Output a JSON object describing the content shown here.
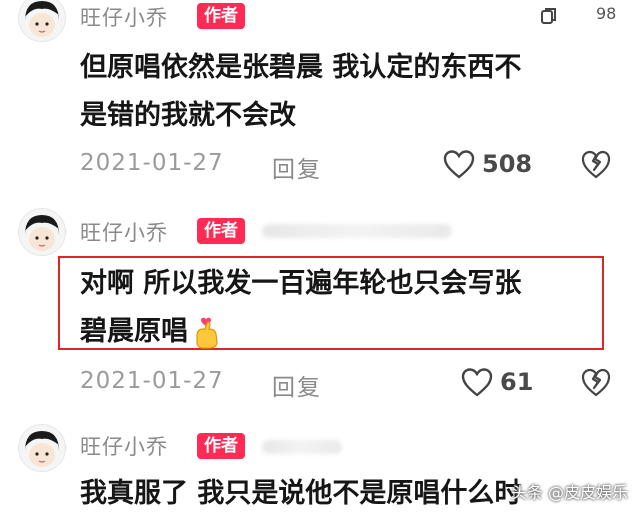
{
  "comments": [
    {
      "username": "旺仔小乔",
      "badge": "作者",
      "lines": [
        "但原唱依然是张碧晨 我认定的东西不",
        "是错的我就不会改"
      ],
      "date": "2021-01-27",
      "reply_label": "回复",
      "likes": "508"
    },
    {
      "username": "旺仔小乔",
      "badge": "作者",
      "lines": [
        "对啊 所以我发一百遍年轮也只会写张",
        "碧晨原唱"
      ],
      "date": "2021-01-27",
      "reply_label": "回复",
      "likes": "61"
    },
    {
      "username": "旺仔小乔",
      "badge": "作者",
      "lines": [
        "我真服了 我只是说他不是原唱什么时"
      ]
    }
  ],
  "top_count": "98",
  "watermark": "头条 @皮皮娱乐",
  "colors": {
    "badge": "#ff2b55",
    "highlight": "#e0242e"
  }
}
